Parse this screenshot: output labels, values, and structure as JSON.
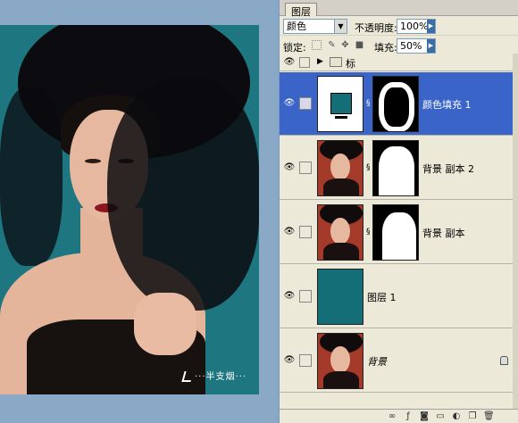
{
  "canvas": {
    "signature": "···半支烟···"
  },
  "panel": {
    "tab_label": "图层",
    "blend_mode": "颜色",
    "opacity_label": "不透明度:",
    "opacity_value": "100%",
    "lock_label": "锁定:",
    "fill_label": "填充:",
    "fill_value": "50%"
  },
  "layers": [
    {
      "name": "标",
      "type": "group"
    },
    {
      "name": "颜色填充 1",
      "type": "fill",
      "selected": true
    },
    {
      "name": "背景 副本 2",
      "type": "photo-mask"
    },
    {
      "name": "背景 副本",
      "type": "photo-mask"
    },
    {
      "name": "图层 1",
      "type": "solid"
    },
    {
      "name": "背景",
      "type": "background"
    }
  ],
  "colors": {
    "teal": "#136e78",
    "selection": "#3a64c8"
  }
}
